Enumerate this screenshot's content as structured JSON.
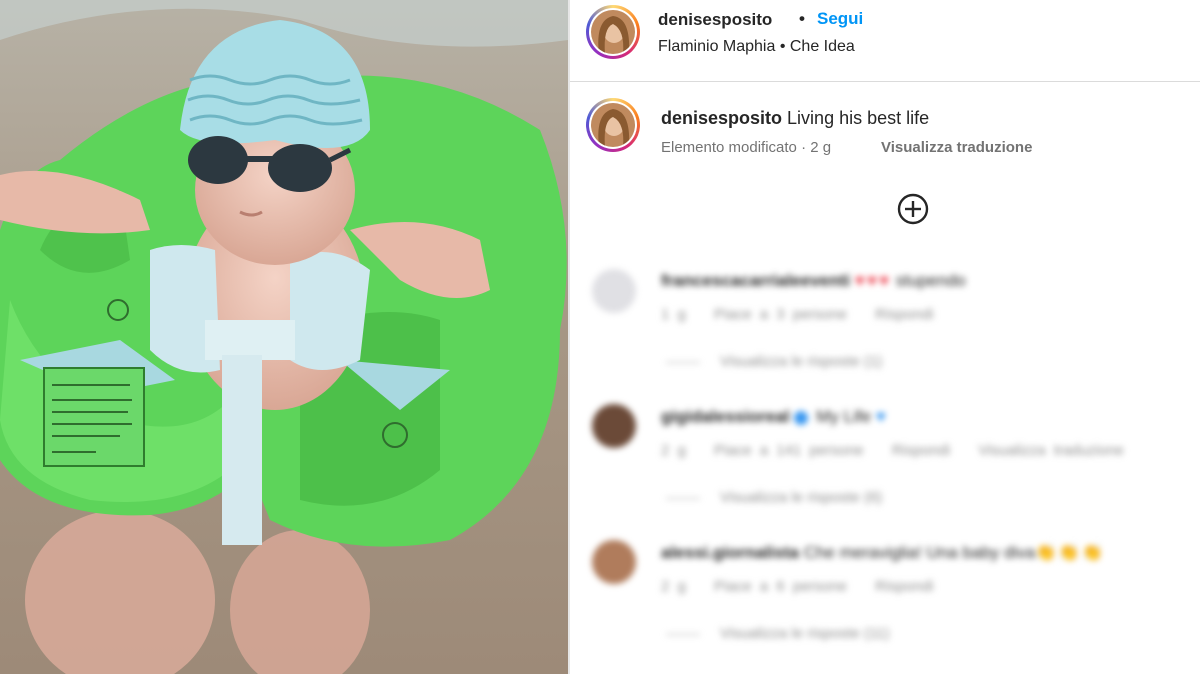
{
  "header": {
    "username": "denisesposito",
    "separator": "•",
    "follow_label": "Segui",
    "audio_line": "Flaminio Maphia • Che Idea"
  },
  "caption": {
    "username": "denisesposito",
    "text": "Living his best life",
    "meta": "Elemento modificato · 2 g",
    "translate_label": "Visualizza traduzione"
  },
  "comments": [
    {
      "username": "francescacarrialeeventi",
      "text": "stupendo",
      "emoji": "♥♥♥",
      "time": "1 g",
      "likes": "Piace a 3 persone",
      "reply": "Rispondi",
      "translate": "",
      "view_replies": "Visualizza le risposte (1)"
    },
    {
      "username": "gigidalessioreal",
      "text": "My Life",
      "emoji": "♥",
      "time": "2 g",
      "likes": "Piace a 141 persone",
      "reply": "Rispondi",
      "translate": "Visualizza traduzione",
      "view_replies": "Visualizza le risposte (6)"
    },
    {
      "username": "alessi.giornalista",
      "text": "Che meraviglia! Una baby diva",
      "emoji": "👏👏👏",
      "time": "2 g",
      "likes": "Piace a 6 persone",
      "reply": "Rispondi",
      "translate": "",
      "view_replies": "Visualizza le risposte (11)"
    }
  ],
  "colors": {
    "accent_blue": "#0095f6",
    "secondary_text": "#737373",
    "border": "#dbdbdb"
  }
}
